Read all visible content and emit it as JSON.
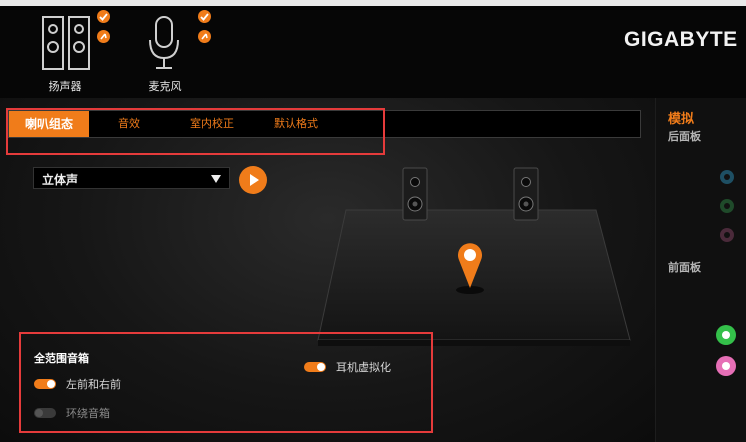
{
  "header": {
    "devices": [
      {
        "label": "扬声器",
        "icon": "speaker-icon"
      },
      {
        "label": "麦克风",
        "icon": "microphone-icon"
      }
    ],
    "logo": "GIGABYTE"
  },
  "tabs": [
    {
      "label": "喇叭组态",
      "active": true
    },
    {
      "label": "音效",
      "active": false
    },
    {
      "label": "室内校正",
      "active": false
    },
    {
      "label": "默认格式",
      "active": false
    }
  ],
  "speaker_config": {
    "selected": "立体声"
  },
  "panel": {
    "title": "全范围音箱",
    "toggles": [
      {
        "label": "左前和右前",
        "on": true
      },
      {
        "label": "环绕音箱",
        "on": false
      },
      {
        "label": "耳机虚拟化",
        "on": true
      }
    ]
  },
  "sidebar": {
    "title": "模拟",
    "rear_label": "后面板",
    "front_label": "前面板",
    "rear_jacks": [
      "#1e4f63",
      "#1f4a2a",
      "#4a2a3a"
    ],
    "front_jacks": [
      "#34c04a",
      "#e66fb6"
    ]
  },
  "colors": {
    "accent": "#f07c1a"
  }
}
